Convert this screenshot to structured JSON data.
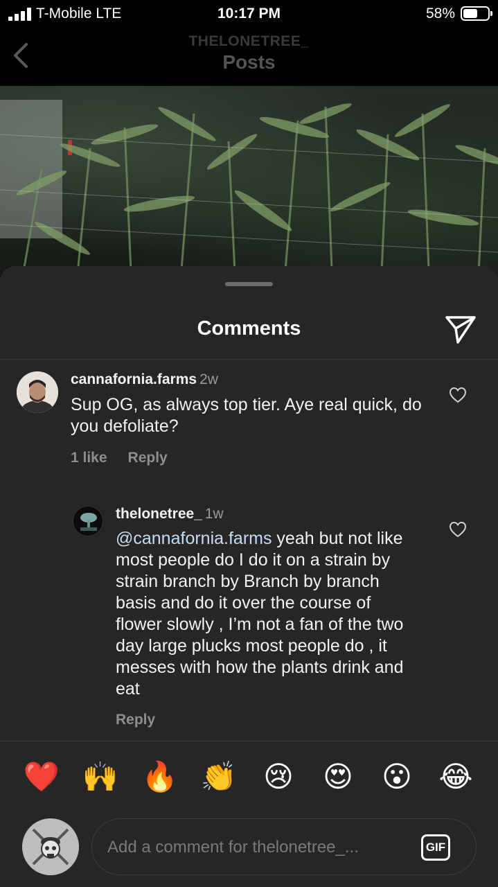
{
  "status_bar": {
    "carrier": "T-Mobile  LTE",
    "time": "10:17 PM",
    "battery_percent": "58%",
    "battery_level": 0.58
  },
  "nav": {
    "username": "THELONETREE_",
    "title": "Posts",
    "back_icon": "chevron-left-icon"
  },
  "sheet": {
    "title": "Comments",
    "share_icon": "paper-plane-icon"
  },
  "comments": [
    {
      "username": "cannafornia.farms",
      "time": "2w",
      "text": "Sup OG, as always top tier. Aye real quick, do you defoliate?",
      "likes": "1 like",
      "reply_label": "Reply"
    }
  ],
  "replies": [
    {
      "username": "thelonetree_",
      "time": "1w",
      "mention": "@cannafornia.farms",
      "text": " yeah but not like most people do I do it on a strain by strain branch by Branch by branch basis and do it over the course of flower slowly , I’m not a fan of the two day large plucks most people do , it messes with how the plants drink and eat",
      "reply_label": "Reply"
    }
  ],
  "emoji_bar": [
    "❤️",
    "🙌",
    "🔥",
    "👏",
    "😢",
    "😍",
    "😮",
    "😂"
  ],
  "composer": {
    "placeholder": "Add a comment for thelonetree_...",
    "gif_label": "GIF"
  },
  "colors": {
    "background": "#000000",
    "sheet": "#262626",
    "mention": "#c6dcf5",
    "meta_text": "#8e8e8e"
  }
}
